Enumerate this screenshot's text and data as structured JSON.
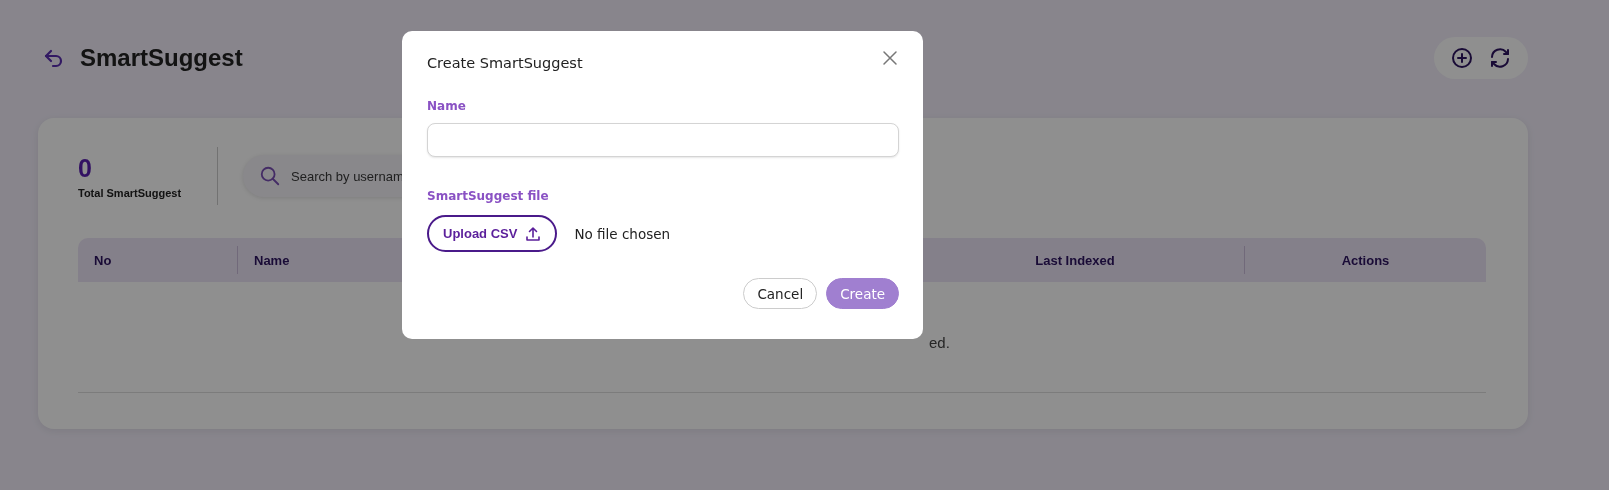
{
  "header": {
    "title": "SmartSuggest"
  },
  "stats": {
    "count": "0",
    "label": "Total SmartSuggest"
  },
  "search": {
    "placeholder": "Search by usernam"
  },
  "table": {
    "columns": [
      {
        "label": "No"
      },
      {
        "label": "Name"
      },
      {
        "label": "Last Indexed"
      },
      {
        "label": "Actions"
      }
    ],
    "empty_message": "ed."
  },
  "dialog": {
    "title": "Create SmartSuggest",
    "name_label": "Name",
    "file_label": "SmartSuggest file",
    "upload_button": "Upload CSV",
    "file_status": "No file chosen",
    "buttons": [
      {
        "label": "Cancel",
        "kind": "secondary"
      },
      {
        "label": "Create",
        "kind": "primary"
      }
    ]
  }
}
